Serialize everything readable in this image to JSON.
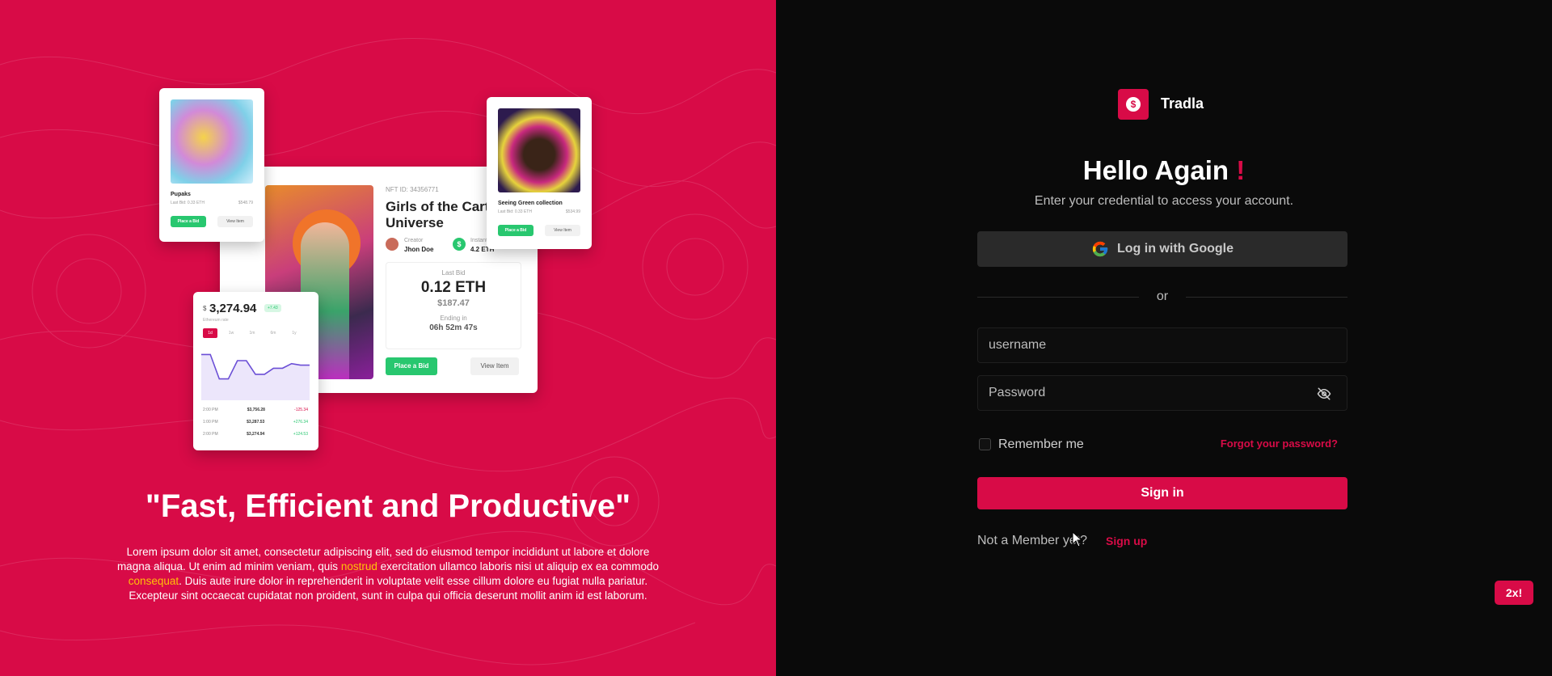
{
  "showcase": {
    "main_card": {
      "nft_id": "NFT ID: 34356771",
      "title": "Girls of the Cartoon Universe",
      "creator_label": "Creator",
      "creator_name": "Jhon Doe",
      "price_label": "Instant Price",
      "price_value": "4.2 ETH",
      "last_bid_label": "Last Bid",
      "last_bid_eth": "0.12 ETH",
      "last_bid_usd": "$187.47",
      "ending_label": "Ending in",
      "ending_value": "06h 52m 47s",
      "place_bid": "Place a Bid",
      "view_item": "View Item"
    },
    "pupaks_card": {
      "title": "Pupaks",
      "sub": "Last Bid: 0.33 ETH",
      "value": "$548.79",
      "place_bid": "Place a Bid",
      "view_item": "View Item"
    },
    "seeing_card": {
      "title": "Seeing Green collection",
      "sub": "Last Bid: 0.33 ETH",
      "value": "$534.99",
      "place_bid": "Place a Bid",
      "view_item": "View Item"
    },
    "graph_card": {
      "currency": "$",
      "value": "3,274.94",
      "badge": "+7.43",
      "sub": "Ethereum rate",
      "tabs": [
        "1d",
        "1w",
        "1m",
        "6m",
        "1y"
      ],
      "chart_values": [
        60,
        60,
        28,
        28,
        52,
        52,
        34,
        34,
        42,
        42,
        48,
        46,
        46
      ],
      "rows": [
        {
          "time": "2:00 PM",
          "value": "$3,756.28",
          "change": "-125.34",
          "dir": "down"
        },
        {
          "time": "1:00 PM",
          "value": "$3,287.53",
          "change": "+276.34",
          "dir": "up"
        },
        {
          "time": "2:00 PM",
          "value": "$3,274.94",
          "change": "+124.53",
          "dir": "up"
        }
      ]
    }
  },
  "tagline": {
    "quote": "\"Fast, Efficient and Productive\"",
    "text_1": "Lorem ipsum dolor sit amet, consectetur adipiscing elit, sed do eiusmod tempor incididunt ut labore et dolore magna aliqua. Ut enim ad minim veniam, quis ",
    "hl_1": "nostrud",
    "text_2": " exercitation ullamco laboris nisi ut aliquip ex ea commodo ",
    "hl_2": "consequat",
    "text_3": ". Duis aute irure dolor in reprehenderit in voluptate velit esse cillum dolore eu fugiat nulla pariatur. Excepteur sint occaecat cupidatat non proident, sunt in culpa qui officia deserunt mollit anim id est laborum."
  },
  "login": {
    "brand": "Tradla",
    "heading": "Hello Again ",
    "heading_mark": "!",
    "subheading": "Enter your credential to access your account.",
    "google_button": "Log in with Google",
    "or": "or",
    "username_placeholder": "username",
    "password_placeholder": "Password",
    "remember": "Remember me",
    "forgot": "Forgot your password?",
    "signin": "Sign in",
    "not_member": "Not a Member yet?",
    "signup": "Sign up"
  },
  "zoom_badge": "2x!",
  "colors": {
    "accent": "#d80b47",
    "green": "#28c76f",
    "background": "#0a0a0a",
    "highlight": "#ffc107"
  },
  "icons": [
    "dollar-coin-icon",
    "google-icon",
    "eye-off-icon",
    "mouse-cursor-icon"
  ]
}
